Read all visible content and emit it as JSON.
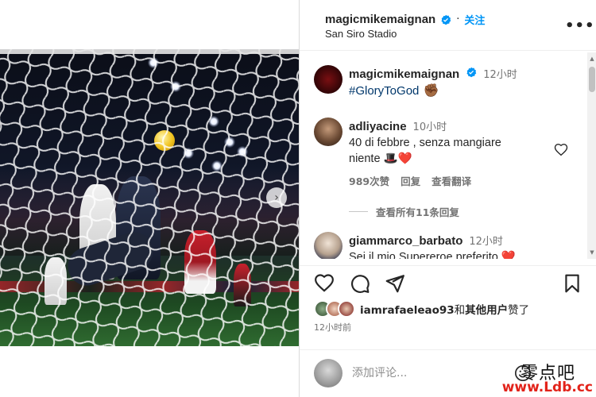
{
  "post": {
    "author": "magicmikemaignan",
    "follow_label": "关注",
    "separator": "·",
    "location": "San Siro Stadio",
    "more_label": "•••"
  },
  "caption": {
    "author": "magicmikemaignan",
    "time": "12小时",
    "text": "#GloryToGod",
    "emoji": "✊🏾"
  },
  "comments": [
    {
      "author": "adliyacine",
      "time": "10小时",
      "text_line1": "40 di febbre , senza mangiare",
      "text_line2": "niente",
      "emoji": "🎩❤️",
      "likes": "989次赞",
      "reply_label": "回复",
      "translate_label": "查看翻译"
    },
    {
      "author": "giammarco_barbato",
      "time": "12小时",
      "text": "Sei il mio Supereroe preferito",
      "emoji": "❤️"
    }
  ],
  "view_replies": "查看所有11条回复",
  "likes": {
    "user": "iamrafaeleao93",
    "connector": "和",
    "others": "其他用户",
    "suffix": "赞了"
  },
  "post_time": "12小时前",
  "add_comment": {
    "placeholder": "添加评论..."
  },
  "carousel": {
    "slides": 4,
    "active_index": 0
  },
  "icons": [
    "verified-icon",
    "more-icon",
    "heart-icon",
    "comment-icon",
    "share-icon",
    "bookmark-icon",
    "emoji-icon",
    "chevron-right-icon"
  ],
  "colors": {
    "verified": "#0095f6",
    "follow": "#0095f6",
    "hashtag": "#00376b",
    "muted": "#737373",
    "watermark_red": "#e2231a"
  },
  "watermark": {
    "cn": "零点吧",
    "url": "www.Ldb.cc"
  }
}
